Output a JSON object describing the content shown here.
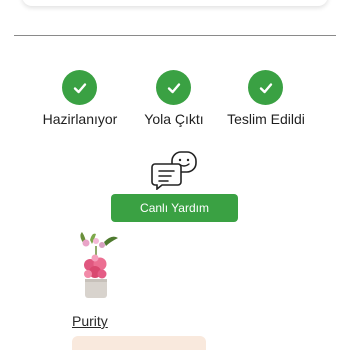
{
  "steps": [
    {
      "label": "Hazirlanıyor",
      "icon": "check-icon",
      "status": "done"
    },
    {
      "label": "Yola Çıktı",
      "icon": "check-icon",
      "status": "done"
    },
    {
      "label": "Teslim Edildi",
      "icon": "check-icon",
      "status": "done"
    }
  ],
  "support": {
    "icon": "chat-support-icon",
    "button_label": "Canlı Yardım"
  },
  "product": {
    "image_icon": "flower-arrangement-icon",
    "brand": "Purity"
  },
  "colors": {
    "accent": "#3aa143",
    "promo_bg": "#f9e9dd"
  }
}
